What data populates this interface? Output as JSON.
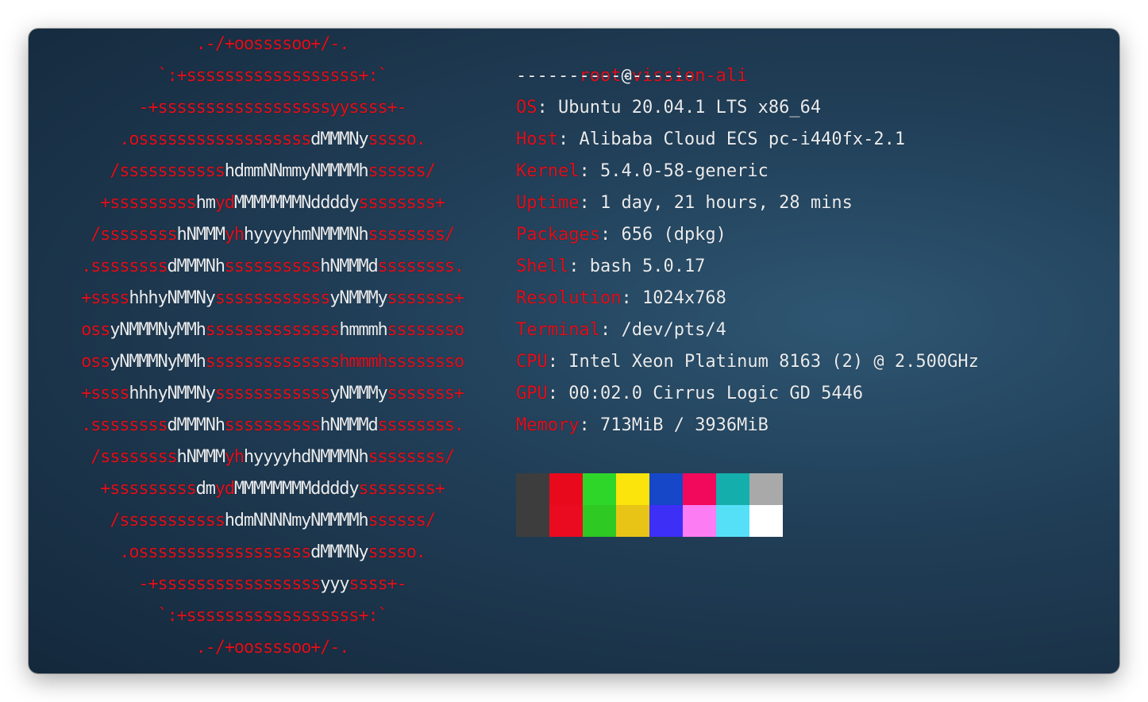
{
  "logo": {
    "lines": [
      [
        {
          "t": ".-/+oossssoo+/-.",
          "c": "r"
        }
      ],
      [
        {
          "t": "`:+ssssssssssssssssss+:`",
          "c": "r"
        }
      ],
      [
        {
          "t": "-+ssssssssssssssssssyyssss+-",
          "c": "r"
        }
      ],
      [
        {
          "t": ".ossssssssssssssssss",
          "c": "r"
        },
        {
          "t": "dMMMNy",
          "c": "w"
        },
        {
          "t": "sssso.",
          "c": "r"
        }
      ],
      [
        {
          "t": "/sssssssssss",
          "c": "r"
        },
        {
          "t": "hdmmNNmmyNMMMMh",
          "c": "w"
        },
        {
          "t": "ssssss/",
          "c": "r"
        }
      ],
      [
        {
          "t": "+sssssssss",
          "c": "r"
        },
        {
          "t": "hm",
          "c": "w"
        },
        {
          "t": "yd",
          "c": "r"
        },
        {
          "t": "MMMMMMMNddddy",
          "c": "w"
        },
        {
          "t": "ssssssss+",
          "c": "r"
        }
      ],
      [
        {
          "t": "/ssssssss",
          "c": "r"
        },
        {
          "t": "hNMMM",
          "c": "w"
        },
        {
          "t": "yh",
          "c": "r"
        },
        {
          "t": "hyyyyhmNMMMNh",
          "c": "w"
        },
        {
          "t": "ssssssss/",
          "c": "r"
        }
      ],
      [
        {
          "t": ".ssssssss",
          "c": "r"
        },
        {
          "t": "dMMMNh",
          "c": "w"
        },
        {
          "t": "ssssssssss",
          "c": "r"
        },
        {
          "t": "hNMMMd",
          "c": "w"
        },
        {
          "t": "ssssssss.",
          "c": "r"
        }
      ],
      [
        {
          "t": "+ssss",
          "c": "r"
        },
        {
          "t": "hhhyNMMNy",
          "c": "w"
        },
        {
          "t": "ssssssssssss",
          "c": "r"
        },
        {
          "t": "yNMMMy",
          "c": "w"
        },
        {
          "t": "sssssss+",
          "c": "r"
        }
      ],
      [
        {
          "t": "oss",
          "c": "r"
        },
        {
          "t": "yNMMMNyMMh",
          "c": "w"
        },
        {
          "t": "ssssssssssssss",
          "c": "r"
        },
        {
          "t": "hmmmh",
          "c": "w"
        },
        {
          "t": "ssssssso",
          "c": "r"
        }
      ],
      [
        {
          "t": "oss",
          "c": "r"
        },
        {
          "t": "yNMMMNyMMh",
          "c": "w"
        },
        {
          "t": "sssssssssssssshmmmhssssssso",
          "c": "r"
        }
      ],
      [
        {
          "t": "+ssss",
          "c": "r"
        },
        {
          "t": "hhhyNMMNy",
          "c": "w"
        },
        {
          "t": "ssssssssssss",
          "c": "r"
        },
        {
          "t": "yNMMMy",
          "c": "w"
        },
        {
          "t": "sssssss+",
          "c": "r"
        }
      ],
      [
        {
          "t": ".ssssssss",
          "c": "r"
        },
        {
          "t": "dMMMNh",
          "c": "w"
        },
        {
          "t": "ssssssssss",
          "c": "r"
        },
        {
          "t": "hNMMMd",
          "c": "w"
        },
        {
          "t": "ssssssss.",
          "c": "r"
        }
      ],
      [
        {
          "t": "/ssssssss",
          "c": "r"
        },
        {
          "t": "hNMMM",
          "c": "w"
        },
        {
          "t": "yh",
          "c": "r"
        },
        {
          "t": "hyyyyhdNMMMNh",
          "c": "w"
        },
        {
          "t": "ssssssss/",
          "c": "r"
        }
      ],
      [
        {
          "t": "+sssssssss",
          "c": "r"
        },
        {
          "t": "dm",
          "c": "w"
        },
        {
          "t": "yd",
          "c": "r"
        },
        {
          "t": "MMMMMMMMddddy",
          "c": "w"
        },
        {
          "t": "ssssssss+",
          "c": "r"
        }
      ],
      [
        {
          "t": "/sssssssssss",
          "c": "r"
        },
        {
          "t": "hdmNNNNmyNMMMMh",
          "c": "w"
        },
        {
          "t": "ssssss/",
          "c": "r"
        }
      ],
      [
        {
          "t": ".ossssssssssssssssss",
          "c": "r"
        },
        {
          "t": "dMMMNy",
          "c": "w"
        },
        {
          "t": "sssso.",
          "c": "r"
        }
      ],
      [
        {
          "t": "-+sssssssssssssssss",
          "c": "r"
        },
        {
          "t": "yyy",
          "c": "w"
        },
        {
          "t": "ssss+-",
          "c": "r"
        }
      ],
      [
        {
          "t": "`:+ssssssssssssssssss+:`",
          "c": "r"
        }
      ],
      [
        {
          "t": ".-/+oossssoo+/-.",
          "c": "r"
        }
      ]
    ]
  },
  "info": {
    "user": "root",
    "at": "@",
    "host": "vission-ali",
    "separator": "-----------------",
    "fields": [
      {
        "key": "OS",
        "value": "Ubuntu 20.04.1 LTS x86_64"
      },
      {
        "key": "Host",
        "value": "Alibaba Cloud ECS pc-i440fx-2.1"
      },
      {
        "key": "Kernel",
        "value": "5.4.0-58-generic"
      },
      {
        "key": "Uptime",
        "value": "1 day, 21 hours, 28 mins"
      },
      {
        "key": "Packages",
        "value": "656 (dpkg)"
      },
      {
        "key": "Shell",
        "value": "bash 5.0.17"
      },
      {
        "key": "Resolution",
        "value": "1024x768"
      },
      {
        "key": "Terminal",
        "value": "/dev/pts/4"
      },
      {
        "key": "CPU",
        "value": "Intel Xeon Platinum 8163 (2) @ 2.500GHz"
      },
      {
        "key": "GPU",
        "value": "00:02.0 Cirrus Logic GD 5446"
      },
      {
        "key": "Memory",
        "value": "713MiB / 3936MiB"
      }
    ],
    "key_separator": ": "
  },
  "palette": {
    "normal": [
      "#3d3d3d",
      "#e8091c",
      "#2fd62a",
      "#fbe30c",
      "#1747c9",
      "#f2095c",
      "#14afad",
      "#a9a9a9"
    ],
    "bright": [
      "#3d3d3d",
      "#eb0b20",
      "#2ec922",
      "#e8c417",
      "#3d2ff5",
      "#fb7cf3",
      "#56e0f8",
      "#ffffff"
    ]
  },
  "colors": {
    "red": "#e0101c",
    "text": "#e9ecef",
    "background": "#213f58"
  }
}
